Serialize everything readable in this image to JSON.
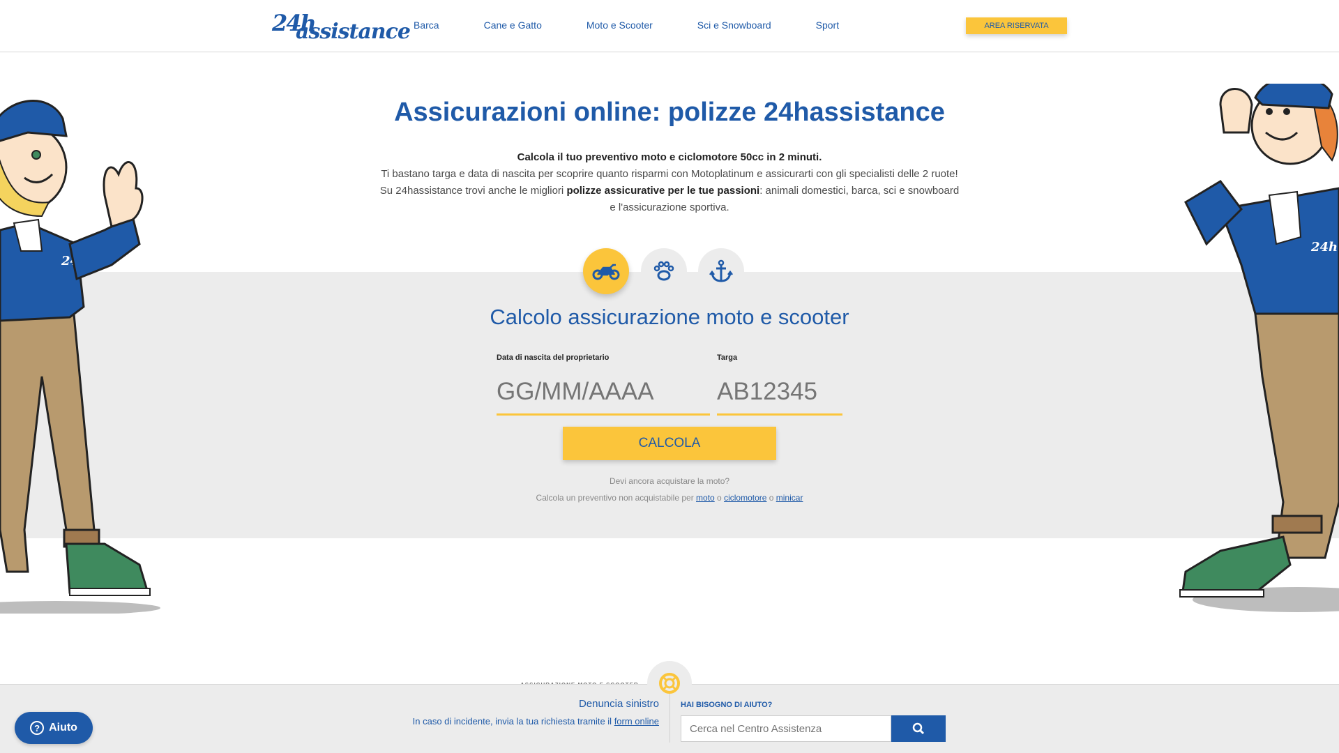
{
  "header": {
    "logo_num": "24h",
    "logo_word": "assistance",
    "nav": [
      "Barca",
      "Cane e Gatto",
      "Moto e Scooter",
      "Sci e Snowboard",
      "Sport"
    ],
    "area_riservata": "AREA RISERVATA"
  },
  "hero": {
    "title": "Assicurazioni online: polizze 24hassistance",
    "line1": "Calcola il tuo preventivo moto e ciclomotore 50cc in 2 minuti.",
    "line2": "Ti bastano targa e data di nascita per scoprire quanto risparmi con Motoplatinum e assicurarti con gli specialisti delle 2 ruote!",
    "line3_pre": "Su 24hassistance trovi anche le migliori ",
    "line3_bold": "polizze assicurative per le tue passioni",
    "line3_post": ": animali domestici, barca, sci e snowboard e l'assicurazione sportiva."
  },
  "categories": [
    {
      "icon": "motorcycle-icon",
      "active": true
    },
    {
      "icon": "paw-icon",
      "active": false
    },
    {
      "icon": "anchor-icon",
      "active": false
    }
  ],
  "calculator": {
    "title": "Calcolo assicurazione moto e scooter",
    "dob_label": "Data di nascita del proprietario",
    "dob_placeholder": "GG/MM/AAAA",
    "plate_label": "Targa",
    "plate_placeholder": "AB12345",
    "button": "CALCOLA",
    "note1": "Devi ancora acquistare la moto?",
    "note2_pre": "Calcola un preventivo non acquistabile per ",
    "link_moto": "moto",
    "sep1": " o ",
    "link_ciclomotore": "ciclomotore",
    "sep2": " o ",
    "link_minicar": "minicar"
  },
  "footer_bar": {
    "hidden_title": "ASSICURAZIONE MOTO E SCOOTER",
    "denuncia_title": "Denuncia sinistro",
    "denuncia_text": "In caso di incidente, invia la tua richiesta tramite il ",
    "denuncia_link": "form online",
    "help_title": "HAI BISOGNO DI AIUTO?",
    "search_placeholder": "Cerca nel Centro Assistenza",
    "aiuto": "Aiuto"
  },
  "colors": {
    "brand_blue": "#1f5aa8",
    "accent_yellow": "#fbc53b",
    "gray_band": "#ececec"
  }
}
